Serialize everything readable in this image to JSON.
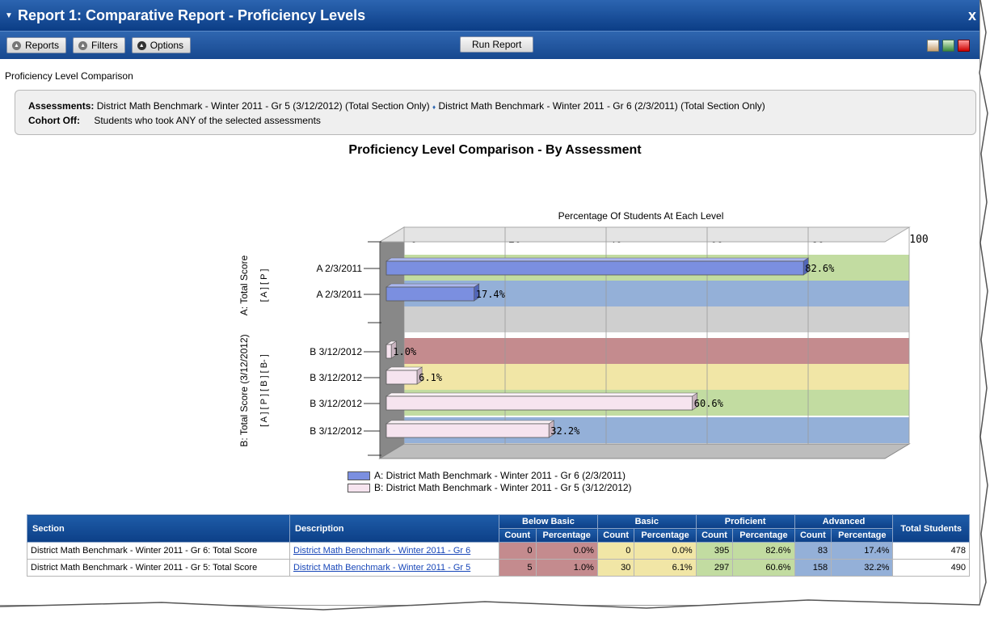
{
  "window": {
    "title": "Report 1: Comparative Report - Proficiency Levels",
    "close_label": "x"
  },
  "toolbar": {
    "reports_label": "Reports",
    "filters_label": "Filters",
    "options_label": "Options",
    "run_label": "Run Report",
    "export_icons": [
      "print-icon",
      "excel-icon",
      "pdf-icon"
    ]
  },
  "report": {
    "subtitle": "Proficiency Level Comparison",
    "assessments_label": "Assessments:",
    "assessment_1": "District Math Benchmark - Winter 2011 - Gr 5 (3/12/2012) (Total Section Only)",
    "assessment_sep": "♦",
    "assessment_2": "District Math Benchmark - Winter 2011 - Gr 6 (2/3/2011) (Total Section Only)",
    "cohort_label": "Cohort Off:",
    "cohort_value": "Students who took ANY of the selected assessments"
  },
  "chart_data": {
    "type": "bar",
    "orientation": "horizontal",
    "title": "Proficiency Level Comparison - By Assessment",
    "xlabel": "Percentage Of Students At Each Level",
    "xlim": [
      0,
      100
    ],
    "xticks": [
      "0",
      "20",
      "40",
      "60",
      "80",
      "100"
    ],
    "groups": [
      {
        "label": "A: Total Score",
        "level_codes": "[ A ] [ P ]",
        "bars": [
          {
            "label": "A 2/3/2011",
            "value": 82.6,
            "value_label": "82.6%",
            "band": "Proficient"
          },
          {
            "label": "A 2/3/2011",
            "value": 17.4,
            "value_label": "17.4%",
            "band": "Advanced"
          }
        ]
      },
      {
        "label": "B: Total Score (3/12/2012)",
        "level_codes": "[ A ] [ P ] [ B ] [ B- ]",
        "bars": [
          {
            "label": "B 3/12/2012",
            "value": 1.0,
            "value_label": "1.0%",
            "band": "Below Basic"
          },
          {
            "label": "B 3/12/2012",
            "value": 6.1,
            "value_label": "6.1%",
            "band": "Basic"
          },
          {
            "label": "B 3/12/2012",
            "value": 60.6,
            "value_label": "60.6%",
            "band": "Proficient"
          },
          {
            "label": "B 3/12/2012",
            "value": 32.2,
            "value_label": "32.2%",
            "band": "Advanced"
          }
        ]
      }
    ],
    "series": [
      {
        "name": "A: District Math Benchmark - Winter 2011 - Gr 6 (2/3/2011)",
        "color": "#7b8fe0"
      },
      {
        "name": "B: District Math Benchmark - Winter 2011 - Gr 5 (3/12/2012)",
        "color": "#f6e4ef"
      }
    ],
    "band_colors": {
      "Below Basic": "#c48b8e",
      "Basic": "#f1e6a6",
      "Proficient": "#c2dca1",
      "Advanced": "#94b0d8",
      "gap": "#cfcfcf"
    },
    "legend": "bottom",
    "grid": true
  },
  "table": {
    "headers": {
      "section": "Section",
      "description": "Description",
      "below_basic": "Below Basic",
      "basic": "Basic",
      "proficient": "Proficient",
      "advanced": "Advanced",
      "total": "Total Students",
      "count": "Count",
      "percentage": "Percentage"
    },
    "rows": [
      {
        "section": "District Math Benchmark - Winter 2011 - Gr 6: Total Score",
        "description": "District Math Benchmark - Winter 2011 - Gr 6",
        "bb_count": "0",
        "bb_pct": "0.0%",
        "ba_count": "0",
        "ba_pct": "0.0%",
        "pr_count": "395",
        "pr_pct": "82.6%",
        "ad_count": "83",
        "ad_pct": "17.4%",
        "total": "478"
      },
      {
        "section": "District Math Benchmark - Winter 2011 - Gr 5: Total Score",
        "description": "District Math Benchmark - Winter 2011 - Gr 5",
        "bb_count": "5",
        "bb_pct": "1.0%",
        "ba_count": "30",
        "ba_pct": "6.1%",
        "pr_count": "297",
        "pr_pct": "60.6%",
        "ad_count": "158",
        "ad_pct": "32.2%",
        "total": "490"
      }
    ]
  }
}
